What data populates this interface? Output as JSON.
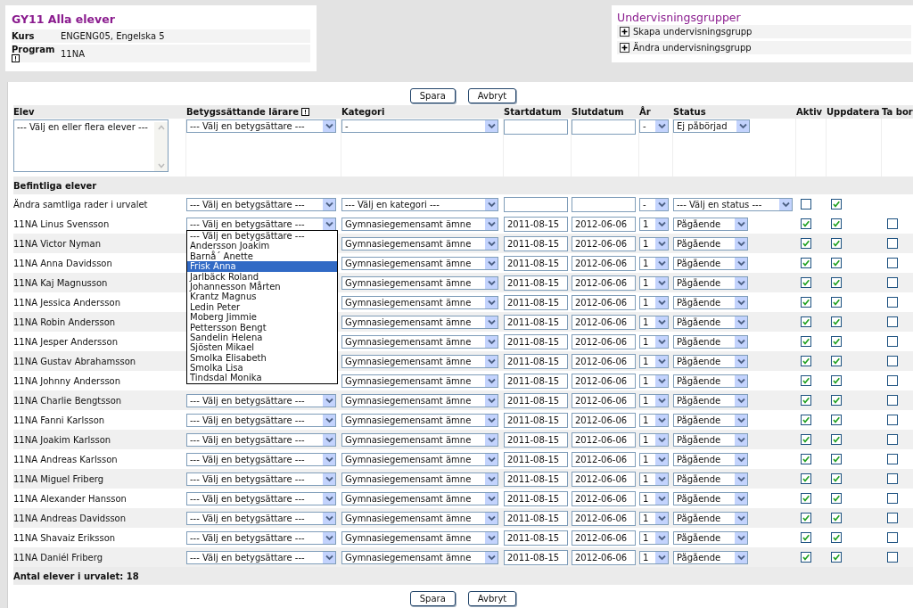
{
  "course_card": {
    "title": "GY11 Alla elever",
    "fields": [
      {
        "label": "Kurs",
        "value": "ENGENG05, Engelska 5",
        "info": false
      },
      {
        "label": "Program",
        "value": "11NA",
        "info": true
      }
    ]
  },
  "groups_card": {
    "title": "Undervisningsgrupper",
    "items": [
      "Skapa undervisningsgrupp",
      "Ändra undervisningsgrupp"
    ]
  },
  "top_buttons": [
    "Spara",
    "Avbryt"
  ],
  "columns": [
    {
      "label": "Elev",
      "info": false
    },
    {
      "label": "Betygssättande lärare",
      "info": true
    },
    {
      "label": "Kategori",
      "info": false
    },
    {
      "label": "Startdatum",
      "info": false
    },
    {
      "label": "Slutdatum",
      "info": false
    },
    {
      "label": "År",
      "info": false
    },
    {
      "label": "Status",
      "info": false
    },
    {
      "label": "Aktiv",
      "info": false
    },
    {
      "label": "Uppdatera",
      "info": false
    },
    {
      "label": "Ta bor",
      "info": false
    }
  ],
  "filter_row": {
    "students": "--- Välj en eller flera elever ---",
    "teacher": "--- Välj en betygsättare ---",
    "category": "-",
    "year": "-",
    "status": "Ej påbörjad"
  },
  "section_title": "Befintliga elever",
  "bulk_row": {
    "label": "Ändra samtliga rader i urvalet",
    "teacher": "--- Välj en betygsättare ---",
    "category": "--- Välj en kategori ---",
    "year": "-",
    "status": "--- Välj en status ---",
    "aktiv": false,
    "uppdatera": true
  },
  "rows": [
    {
      "name": "11NA Linus Svensson",
      "teacher": "--- Välj en betygsättare ---",
      "category": "Gymnasiegemensamt ämne",
      "start": "2011-08-15",
      "end": "2012-06-06",
      "year": "1",
      "status": "Pågående",
      "aktiv": true,
      "uppdatera": true,
      "ta_bort": false
    },
    {
      "name": "11NA Victor Nyman",
      "category": "Gymnasiegemensamt ämne",
      "start": "2011-08-15",
      "end": "2012-06-06",
      "year": "1",
      "status": "Pågående",
      "aktiv": true,
      "uppdatera": true,
      "ta_bort": false
    },
    {
      "name": "11NA Anna Davidsson",
      "category": "Gymnasiegemensamt ämne",
      "start": "2011-08-15",
      "end": "2012-06-06",
      "year": "1",
      "status": "Pågående",
      "aktiv": true,
      "uppdatera": true,
      "ta_bort": false
    },
    {
      "name": "11NA Kaj Magnusson",
      "category": "Gymnasiegemensamt ämne",
      "start": "2011-08-15",
      "end": "2012-06-06",
      "year": "1",
      "status": "Pågående",
      "aktiv": true,
      "uppdatera": true,
      "ta_bort": false
    },
    {
      "name": "11NA Jessica Andersson",
      "category": "Gymnasiegemensamt ämne",
      "start": "2011-08-15",
      "end": "2012-06-06",
      "year": "1",
      "status": "Pågående",
      "aktiv": true,
      "uppdatera": true,
      "ta_bort": false
    },
    {
      "name": "11NA Robin Andersson",
      "category": "Gymnasiegemensamt ämne",
      "start": "2011-08-15",
      "end": "2012-06-06",
      "year": "1",
      "status": "Pågående",
      "aktiv": true,
      "uppdatera": true,
      "ta_bort": false
    },
    {
      "name": "11NA Jesper Andersson",
      "category": "Gymnasiegemensamt ämne",
      "start": "2011-08-15",
      "end": "2012-06-06",
      "year": "1",
      "status": "Pågående",
      "aktiv": true,
      "uppdatera": true,
      "ta_bort": false
    },
    {
      "name": "11NA Gustav Abrahamsson",
      "category": "Gymnasiegemensamt ämne",
      "start": "2011-08-15",
      "end": "2012-06-06",
      "year": "1",
      "status": "Pågående",
      "aktiv": true,
      "uppdatera": true,
      "ta_bort": false
    },
    {
      "name": "11NA Johnny Andersson",
      "category": "Gymnasiegemensamt ämne",
      "start": "2011-08-15",
      "end": "2012-06-06",
      "year": "1",
      "status": "Pågående",
      "aktiv": true,
      "uppdatera": true,
      "ta_bort": false
    },
    {
      "name": "11NA Charlie Bengtsson",
      "teacher": "--- Välj en betygsättare ---",
      "category": "Gymnasiegemensamt ämne",
      "start": "2011-08-15",
      "end": "2012-06-06",
      "year": "1",
      "status": "Pågående",
      "aktiv": true,
      "uppdatera": true,
      "ta_bort": false
    },
    {
      "name": "11NA Fanni Karlsson",
      "teacher": "--- Välj en betygsättare ---",
      "category": "Gymnasiegemensamt ämne",
      "start": "2011-08-15",
      "end": "2012-06-06",
      "year": "1",
      "status": "Pågående",
      "aktiv": true,
      "uppdatera": true,
      "ta_bort": false
    },
    {
      "name": "11NA Joakim Karlsson",
      "teacher": "--- Välj en betygsättare ---",
      "category": "Gymnasiegemensamt ämne",
      "start": "2011-08-15",
      "end": "2012-06-06",
      "year": "1",
      "status": "Pågående",
      "aktiv": true,
      "uppdatera": true,
      "ta_bort": false
    },
    {
      "name": "11NA Andreas Karlsson",
      "teacher": "--- Välj en betygsättare ---",
      "category": "Gymnasiegemensamt ämne",
      "start": "2011-08-15",
      "end": "2012-06-06",
      "year": "1",
      "status": "Pågående",
      "aktiv": true,
      "uppdatera": true,
      "ta_bort": false
    },
    {
      "name": "11NA Miguel Friberg",
      "teacher": "--- Välj en betygsättare ---",
      "category": "Gymnasiegemensamt ämne",
      "start": "2011-08-15",
      "end": "2012-06-06",
      "year": "1",
      "status": "Pågående",
      "aktiv": true,
      "uppdatera": true,
      "ta_bort": false
    },
    {
      "name": "11NA Alexander Hansson",
      "teacher": "--- Välj en betygsättare ---",
      "category": "Gymnasiegemensamt ämne",
      "start": "2011-08-15",
      "end": "2012-06-06",
      "year": "1",
      "status": "Pågående",
      "aktiv": true,
      "uppdatera": true,
      "ta_bort": false
    },
    {
      "name": "11NA Andreas Davidsson",
      "teacher": "--- Välj en betygsättare ---",
      "category": "Gymnasiegemensamt ämne",
      "start": "2011-08-15",
      "end": "2012-06-06",
      "year": "1",
      "status": "Pågående",
      "aktiv": true,
      "uppdatera": true,
      "ta_bort": false
    },
    {
      "name": "11NA Shavaiz Eriksson",
      "teacher": "--- Välj en betygsättare ---",
      "category": "Gymnasiegemensamt ämne",
      "start": "2011-08-15",
      "end": "2012-06-06",
      "year": "1",
      "status": "Pågående",
      "aktiv": true,
      "uppdatera": true,
      "ta_bort": false
    },
    {
      "name": "11NA Daniél Friberg",
      "teacher": "--- Välj en betygsättare ---",
      "category": "Gymnasiegemensamt ämne",
      "start": "2011-08-15",
      "end": "2012-06-06",
      "year": "1",
      "status": "Pågående",
      "aktiv": true,
      "uppdatera": true,
      "ta_bort": false
    }
  ],
  "teacher_dropdown": {
    "options": [
      {
        "label": "--- Välj en betygsättare ---",
        "selected": false
      },
      {
        "label": "Andersson Joakim",
        "selected": false
      },
      {
        "label": "Barnå´ Anette",
        "selected": false
      },
      {
        "label": "Frisk Anna",
        "selected": true
      },
      {
        "label": "Jarlbäck Roland",
        "selected": false
      },
      {
        "label": "Johannesson Mårten",
        "selected": false
      },
      {
        "label": "Krantz Magnus",
        "selected": false
      },
      {
        "label": "Ledin Peter",
        "selected": false
      },
      {
        "label": "Moberg Jimmie",
        "selected": false
      },
      {
        "label": "Pettersson Bengt",
        "selected": false
      },
      {
        "label": "Sandelin Helena",
        "selected": false
      },
      {
        "label": "Sjösten Mikael",
        "selected": false
      },
      {
        "label": "Smolka Elisabeth",
        "selected": false
      },
      {
        "label": "Smolka Lisa",
        "selected": false
      },
      {
        "label": "Tindsdal Monika",
        "selected": false
      }
    ]
  },
  "summary": "Antal elever i urvalet: 18",
  "bottom_buttons": [
    "Spara",
    "Avbryt"
  ]
}
